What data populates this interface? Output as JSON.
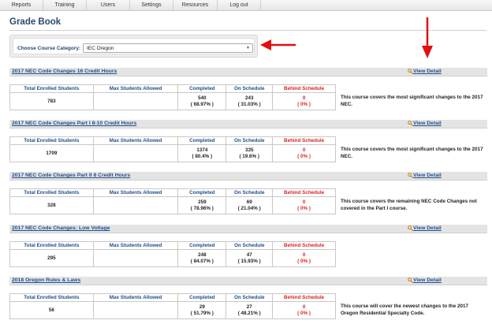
{
  "nav": {
    "items": [
      "Reports",
      "Training",
      "Users",
      "Settings",
      "Resources",
      "Log out"
    ]
  },
  "page": {
    "title": "Grade Book"
  },
  "filter": {
    "label": "Choose Course Category:",
    "selected": "IEC Oregon"
  },
  "colors": {
    "link": "#1f4e8c",
    "behind": "#e02020",
    "annotation_arrow": "#e01010"
  },
  "table_headers": {
    "total": "Total Enrolled Students",
    "max": "Max Students Allowed",
    "completed": "Completed",
    "on_schedule": "On Schedule",
    "behind": "Behind Schedule"
  },
  "view_detail_label": "View Detail",
  "courses": [
    {
      "name": "2017 NEC Code Changes 16 Credit Hours",
      "total": "783",
      "max": "",
      "completed": "540",
      "completed_pct": "( 68.97% )",
      "on_schedule": "243",
      "on_schedule_pct": "( 31.03% )",
      "behind": "0",
      "behind_pct": "( 0% )",
      "description": "This course covers the most significant changes to the 2017 NEC."
    },
    {
      "name": "2017 NEC Code Changes Part I 8-10 Credit Hours",
      "total": "1709",
      "max": "",
      "completed": "1374",
      "completed_pct": "( 80.4% )",
      "on_schedule": "335",
      "on_schedule_pct": "( 19.6% )",
      "behind": "0",
      "behind_pct": "( 0% )",
      "description": "This course covers the most significant changes to the 2017 NEC."
    },
    {
      "name": "2017 NEC Code Changes Part II 8 Credit Hours",
      "total": "328",
      "max": "",
      "completed": "259",
      "completed_pct": "( 78.96% )",
      "on_schedule": "69",
      "on_schedule_pct": "( 21.04% )",
      "behind": "0",
      "behind_pct": "( 0% )",
      "description": "This course covers the remaining NEC Code Changes not covered in the Part I course."
    },
    {
      "name": "2017 NEC Code Changes: Low Voltage",
      "total": "295",
      "max": "",
      "completed": "248",
      "completed_pct": "( 84.07% )",
      "on_schedule": "47",
      "on_schedule_pct": "( 15.93% )",
      "behind": "0",
      "behind_pct": "( 0% )",
      "description": ""
    },
    {
      "name": "2018 Oregon Rules & Laws",
      "total": "56",
      "max": "",
      "completed": "29",
      "completed_pct": "( 51.79% )",
      "on_schedule": "27",
      "on_schedule_pct": "( 48.21% )",
      "behind": "0",
      "behind_pct": "( 0% )",
      "description": "This course will cover the newest changes to the 2017 Oregon Residential Specialty Code."
    }
  ]
}
